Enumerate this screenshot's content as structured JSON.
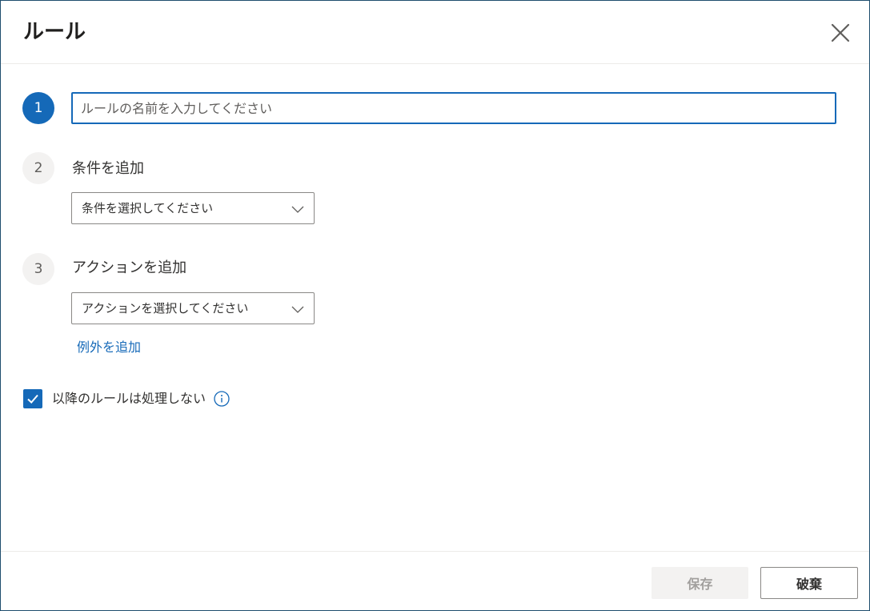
{
  "dialog": {
    "title": "ルール"
  },
  "steps": [
    {
      "number": "1",
      "input_placeholder": "ルールの名前を入力してください",
      "input_value": ""
    },
    {
      "number": "2",
      "label": "条件を追加",
      "dropdown_value": "条件を選択してください"
    },
    {
      "number": "3",
      "label": "アクションを追加",
      "dropdown_value": "アクションを選択してください"
    }
  ],
  "add_exception_link": "例外を追加",
  "stop_processing": {
    "label": "以降のルールは処理しない",
    "checked": true
  },
  "footer": {
    "save_label": "保存",
    "discard_label": "破棄"
  },
  "colors": {
    "accent": "#1569b8",
    "text": "#323130",
    "disabled_bg": "#f3f2f1",
    "disabled_text": "#a19f9d"
  },
  "icons": {
    "close": "close-icon",
    "chevron": "chevron-down-icon",
    "check": "checkmark-icon",
    "info": "info-icon"
  }
}
